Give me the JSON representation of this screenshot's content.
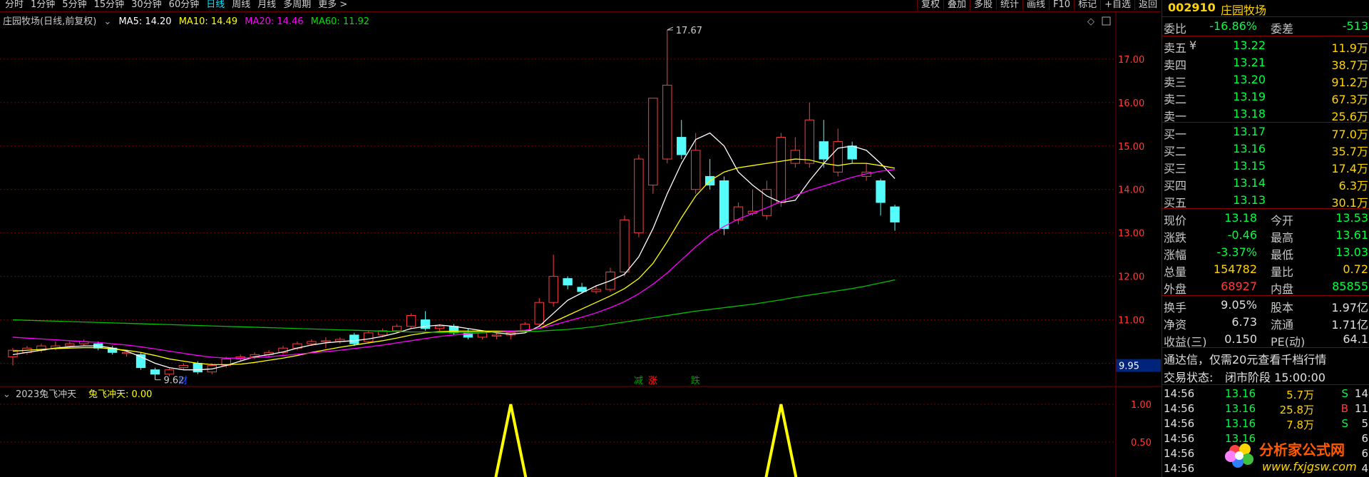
{
  "topbar": {
    "tabs": [
      "分时",
      "1分钟",
      "5分钟",
      "15分钟",
      "30分钟",
      "60分钟",
      "日线",
      "周线",
      "月线",
      "多周期",
      "更多 >"
    ],
    "active_tab": "日线",
    "tools": [
      "复权",
      "叠加",
      "多股",
      "统计",
      "画线",
      "F10",
      "标记",
      "+自选",
      "返回"
    ]
  },
  "info": {
    "title": "庄园牧场(日线,前复权)",
    "ma5": "MA5: 14.20",
    "ma10": "MA10: 14.49",
    "ma20": "MA20: 14.46",
    "ma60": "MA60: 11.92"
  },
  "colors": {
    "up": "#ff3c3c",
    "down": "#54fcfc",
    "ma5": "#ffffff",
    "ma10": "#ffff00",
    "ma20": "#ff00ff",
    "ma60": "#00c000",
    "grid": "#7a0000",
    "axis_text": "#ff3c3c",
    "indicator_line": "#ffff00"
  },
  "chart_data": {
    "type": "candlestick",
    "ylim": [
      9.5,
      17.9
    ],
    "y_ticks": [
      "17.00",
      "16.00",
      "15.00",
      "14.00",
      "13.00",
      "12.00",
      "11.00",
      "10.00"
    ],
    "y_tick_values": [
      17,
      16,
      15,
      14,
      13,
      12,
      11,
      10
    ],
    "current_price_tag": "9.95",
    "high_annotation": "17.67",
    "low_annotation": "9.62",
    "event_markers": [
      "财",
      "减",
      "涨",
      "跌"
    ],
    "candles": [
      [
        10.15,
        10.3,
        9.95,
        10.35
      ],
      [
        10.25,
        10.35,
        10.2,
        10.4
      ],
      [
        10.3,
        10.4,
        10.25,
        10.45
      ],
      [
        10.35,
        10.4,
        10.3,
        10.5
      ],
      [
        10.4,
        10.45,
        10.35,
        10.5
      ],
      [
        10.45,
        10.5,
        10.4,
        10.55
      ],
      [
        10.45,
        10.35,
        10.3,
        10.5
      ],
      [
        10.35,
        10.25,
        10.2,
        10.4
      ],
      [
        10.25,
        10.25,
        10.15,
        10.3
      ],
      [
        10.2,
        9.9,
        9.85,
        10.25
      ],
      [
        9.85,
        9.75,
        9.62,
        9.9
      ],
      [
        9.75,
        9.85,
        9.7,
        9.9
      ],
      [
        9.9,
        9.95,
        9.85,
        10.0
      ],
      [
        10.0,
        9.8,
        9.75,
        10.05
      ],
      [
        9.8,
        9.95,
        9.75,
        10.0
      ],
      [
        9.95,
        10.1,
        9.9,
        10.15
      ],
      [
        10.1,
        10.15,
        10.05,
        10.2
      ],
      [
        10.15,
        10.2,
        10.1,
        10.25
      ],
      [
        10.2,
        10.25,
        10.15,
        10.3
      ],
      [
        10.25,
        10.35,
        10.2,
        10.4
      ],
      [
        10.35,
        10.45,
        10.3,
        10.5
      ],
      [
        10.45,
        10.5,
        10.4,
        10.55
      ],
      [
        10.5,
        10.52,
        10.35,
        10.6
      ],
      [
        10.5,
        10.55,
        10.45,
        10.6
      ],
      [
        10.65,
        10.45,
        10.4,
        10.7
      ],
      [
        10.5,
        10.7,
        10.45,
        10.75
      ],
      [
        10.65,
        10.75,
        10.6,
        10.8
      ],
      [
        10.75,
        10.85,
        10.7,
        10.9
      ],
      [
        10.85,
        11.1,
        10.8,
        11.15
      ],
      [
        11.0,
        10.8,
        10.75,
        11.2
      ],
      [
        10.8,
        10.85,
        10.75,
        10.9
      ],
      [
        10.85,
        10.7,
        10.65,
        10.9
      ],
      [
        10.7,
        10.6,
        10.55,
        10.8
      ],
      [
        10.6,
        10.7,
        10.55,
        10.75
      ],
      [
        10.65,
        10.65,
        10.55,
        10.7
      ],
      [
        10.65,
        10.7,
        10.55,
        10.75
      ],
      [
        10.75,
        10.9,
        10.7,
        10.95
      ],
      [
        10.9,
        11.4,
        10.85,
        11.5
      ],
      [
        11.4,
        12.0,
        11.3,
        12.5
      ],
      [
        11.95,
        11.8,
        11.7,
        12.0
      ],
      [
        11.75,
        11.65,
        11.6,
        11.85
      ],
      [
        11.65,
        11.7,
        11.6,
        11.8
      ],
      [
        11.7,
        12.1,
        11.65,
        12.2
      ],
      [
        12.1,
        13.3,
        12.0,
        13.4
      ],
      [
        13.0,
        14.7,
        12.9,
        14.8
      ],
      [
        14.1,
        16.1,
        13.9,
        16.1
      ],
      [
        14.7,
        16.4,
        14.6,
        17.67
      ],
      [
        15.2,
        14.8,
        14.7,
        15.6
      ],
      [
        14.0,
        14.9,
        13.9,
        15.3
      ],
      [
        14.3,
        14.1,
        14.0,
        14.7
      ],
      [
        14.2,
        13.1,
        12.95,
        14.3
      ],
      [
        13.3,
        13.6,
        13.2,
        13.7
      ],
      [
        13.45,
        13.5,
        13.4,
        14.0
      ],
      [
        13.4,
        14.0,
        13.3,
        14.2
      ],
      [
        13.7,
        15.2,
        13.6,
        15.3
      ],
      [
        14.6,
        14.9,
        14.5,
        15.2
      ],
      [
        14.6,
        15.6,
        14.5,
        16.0
      ],
      [
        15.1,
        14.7,
        14.5,
        15.6
      ],
      [
        14.4,
        15.1,
        14.3,
        15.4
      ],
      [
        15.0,
        14.7,
        14.6,
        15.1
      ],
      [
        14.3,
        14.4,
        14.2,
        14.6
      ],
      [
        14.2,
        13.7,
        13.4,
        14.25
      ],
      [
        13.6,
        13.25,
        13.05,
        13.65
      ]
    ],
    "ma_series": {
      "MA5": [
        10.2,
        10.25,
        10.3,
        10.35,
        10.38,
        10.4,
        10.4,
        10.35,
        10.28,
        10.15,
        10.0,
        9.9,
        9.85,
        9.85,
        9.87,
        9.95,
        10.05,
        10.15,
        10.2,
        10.26,
        10.35,
        10.42,
        10.47,
        10.5,
        10.52,
        10.56,
        10.62,
        10.7,
        10.8,
        10.85,
        10.88,
        10.85,
        10.8,
        10.75,
        10.7,
        10.67,
        10.7,
        10.85,
        11.15,
        11.45,
        11.62,
        11.78,
        11.9,
        12.05,
        12.45,
        13.1,
        13.9,
        14.6,
        15.15,
        15.3,
        15.0,
        14.4,
        14.1,
        13.85,
        13.7,
        13.75,
        14.2,
        14.6,
        14.95,
        15.0,
        14.9,
        14.6,
        14.25
      ],
      "MA10": [
        10.28,
        10.3,
        10.32,
        10.34,
        10.35,
        10.36,
        10.36,
        10.33,
        10.3,
        10.25,
        10.18,
        10.1,
        10.05,
        10.0,
        9.97,
        9.97,
        9.98,
        10.02,
        10.07,
        10.12,
        10.18,
        10.25,
        10.31,
        10.37,
        10.42,
        10.47,
        10.52,
        10.58,
        10.65,
        10.7,
        10.73,
        10.74,
        10.74,
        10.74,
        10.74,
        10.74,
        10.75,
        10.8,
        10.95,
        11.1,
        11.25,
        11.4,
        11.55,
        11.72,
        11.95,
        12.3,
        12.8,
        13.35,
        13.85,
        14.2,
        14.4,
        14.5,
        14.55,
        14.6,
        14.65,
        14.7,
        14.68,
        14.6,
        14.55,
        14.6,
        14.6,
        14.55,
        14.49
      ],
      "MA20": [
        10.6,
        10.58,
        10.56,
        10.54,
        10.52,
        10.5,
        10.48,
        10.45,
        10.42,
        10.38,
        10.33,
        10.28,
        10.23,
        10.18,
        10.14,
        10.12,
        10.12,
        10.13,
        10.15,
        10.18,
        10.21,
        10.24,
        10.27,
        10.3,
        10.34,
        10.38,
        10.42,
        10.47,
        10.52,
        10.57,
        10.62,
        10.65,
        10.68,
        10.7,
        10.72,
        10.74,
        10.76,
        10.8,
        10.88,
        10.97,
        11.06,
        11.16,
        11.28,
        11.42,
        11.6,
        11.82,
        12.08,
        12.38,
        12.68,
        12.95,
        13.15,
        13.32,
        13.45,
        13.58,
        13.72,
        13.86,
        13.98,
        14.08,
        14.18,
        14.28,
        14.36,
        14.42,
        14.46
      ],
      "MA60": [
        11.0,
        10.99,
        10.98,
        10.97,
        10.96,
        10.95,
        10.94,
        10.93,
        10.92,
        10.91,
        10.9,
        10.89,
        10.88,
        10.87,
        10.86,
        10.85,
        10.84,
        10.83,
        10.82,
        10.81,
        10.8,
        10.79,
        10.78,
        10.77,
        10.76,
        10.75,
        10.74,
        10.73,
        10.72,
        10.72,
        10.71,
        10.71,
        10.71,
        10.71,
        10.72,
        10.72,
        10.73,
        10.74,
        10.76,
        10.78,
        10.81,
        10.85,
        10.9,
        10.95,
        11.0,
        11.05,
        11.1,
        11.15,
        11.2,
        11.24,
        11.28,
        11.32,
        11.36,
        11.41,
        11.46,
        11.52,
        11.57,
        11.62,
        11.67,
        11.72,
        11.78,
        11.85,
        11.92
      ]
    },
    "indicator": {
      "name": "2023兔飞冲天",
      "label": "兔飞冲天: 0.00",
      "y_ticks": [
        "1.00",
        "0.50"
      ],
      "y_tick_values": [
        1.0,
        0.5
      ],
      "signals": [
        35,
        54
      ]
    }
  },
  "panel": {
    "code": "002910",
    "name": "庄园牧场",
    "weibi_label": "委比",
    "weibi": "-16.86%",
    "weicha_label": "委差",
    "weicha": "-513",
    "asks": [
      {
        "label": "卖五",
        "mark": "¥",
        "price": "13.22",
        "vol": "11.9万"
      },
      {
        "label": "卖四",
        "mark": "",
        "price": "13.21",
        "vol": "38.7万"
      },
      {
        "label": "卖三",
        "mark": "",
        "price": "13.20",
        "vol": "91.2万"
      },
      {
        "label": "卖二",
        "mark": "",
        "price": "13.19",
        "vol": "67.3万"
      },
      {
        "label": "卖一",
        "mark": "",
        "price": "13.18",
        "vol": "25.6万"
      }
    ],
    "bids": [
      {
        "label": "买一",
        "price": "13.17",
        "vol": "77.0万"
      },
      {
        "label": "买二",
        "price": "13.16",
        "vol": "35.7万"
      },
      {
        "label": "买三",
        "price": "13.15",
        "vol": "17.4万"
      },
      {
        "label": "买四",
        "price": "13.14",
        "vol": "6.3万"
      },
      {
        "label": "买五",
        "price": "13.13",
        "vol": "30.1万"
      }
    ],
    "quote": [
      {
        "l1": "现价",
        "v1": "13.18",
        "c1": "green",
        "l2": "今开",
        "v2": "13.53",
        "c2": "green"
      },
      {
        "l1": "涨跌",
        "v1": "-0.46",
        "c1": "green",
        "l2": "最高",
        "v2": "13.61",
        "c2": "green"
      },
      {
        "l1": "涨幅",
        "v1": "-3.37%",
        "c1": "green",
        "l2": "最低",
        "v2": "13.03",
        "c2": "green"
      },
      {
        "l1": "总量",
        "v1": "154782",
        "c1": "yellow",
        "l2": "量比",
        "v2": "0.72",
        "c2": "yellow"
      },
      {
        "l1": "外盘",
        "v1": "68927",
        "c1": "red",
        "l2": "内盘",
        "v2": "85855",
        "c2": "green"
      }
    ],
    "fund": [
      {
        "l1": "换手",
        "v1": "9.05%",
        "l2": "股本",
        "v2": "1.97亿"
      },
      {
        "l1": "净资",
        "v1": "6.73",
        "l2": "流通",
        "v2": "1.71亿"
      },
      {
        "l1": "收益(三)",
        "v1": "0.150",
        "l2": "PE(动)",
        "v2": "64.1"
      }
    ],
    "ad": "通达信，仅需20元查看千档行情",
    "status_label": "交易状态:",
    "status": "闭市阶段 15:00:00",
    "ticks": [
      {
        "t": "14:56",
        "p": "13.16",
        "v": "5.7万",
        "d": "S",
        "n": "14"
      },
      {
        "t": "14:56",
        "p": "13.16",
        "v": "25.8万",
        "d": "B",
        "n": "11"
      },
      {
        "t": "14:56",
        "p": "13.16",
        "v": "7.8万",
        "d": "S",
        "n": "5"
      },
      {
        "t": "14:56",
        "p": "13.16",
        "v": "",
        "d": "",
        "n": "6"
      },
      {
        "t": "14:56",
        "p": "",
        "v": "",
        "d": "",
        "n": "6"
      },
      {
        "t": "14:56",
        "p": "",
        "v": "",
        "d": "",
        "n": "4"
      }
    ]
  },
  "logo": {
    "title": "分析家公式网",
    "url": "www.fxjgsw.com"
  }
}
